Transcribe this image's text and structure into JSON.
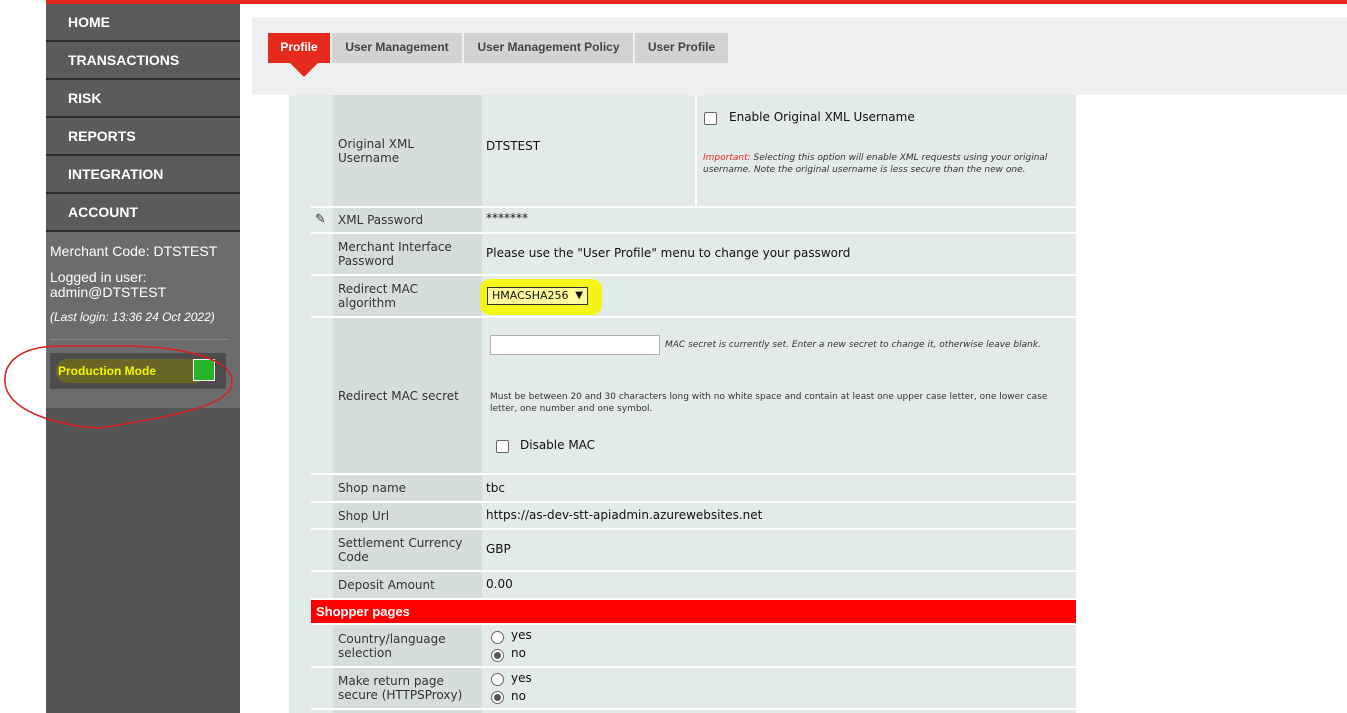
{
  "sidebar": {
    "nav": [
      "HOME",
      "TRANSACTIONS",
      "RISK",
      "REPORTS",
      "INTEGRATION",
      "ACCOUNT"
    ],
    "merchant_code": "Merchant Code: DTSTEST",
    "logged_in_label": "Logged in user:",
    "logged_in_user": "admin@DTSTEST",
    "last_login": "(Last login: 13:36 24 Oct 2022)",
    "production_mode_label": "Production Mode"
  },
  "tabs": [
    "Profile",
    "User Management",
    "User Management Policy",
    "User Profile"
  ],
  "form": {
    "original_xml_username": {
      "label": "Original XML Username",
      "value": "DTSTEST",
      "checkbox_label": "Enable Original XML Username",
      "note_important": "Important:",
      "note_text": " Selecting this option will enable XML requests using your original username. Note the original username is less secure than the new one."
    },
    "xml_password": {
      "label": "XML Password",
      "value": "*******"
    },
    "merchant_interface_password": {
      "label": "Merchant Interface Password",
      "value": "Please use the \"User Profile\" menu to change your password"
    },
    "redirect_mac_algorithm": {
      "label": "Redirect MAC algorithm",
      "selected": "HMACSHA256"
    },
    "redirect_mac_secret": {
      "label": "Redirect MAC secret",
      "note1": "MAC secret is currently set. Enter a new secret to change it, otherwise leave blank.",
      "note2": "Must be between 20 and 30 characters long with no white space and contain at least one upper case letter, one lower case letter, one number and one symbol.",
      "disable_label": "Disable MAC"
    },
    "shop_name": {
      "label": "Shop name",
      "value": "tbc"
    },
    "shop_url": {
      "label": "Shop Url",
      "value": "https://as-dev-stt-apiadmin.azurewebsites.net"
    },
    "settlement_currency": {
      "label": "Settlement Currency Code",
      "value": "GBP"
    },
    "deposit_amount": {
      "label": "Deposit Amount",
      "value": "0.00"
    }
  },
  "shopper_pages": {
    "title": "Shopper pages",
    "country_language": {
      "label": "Country/language selection",
      "yes": "yes",
      "no": "no",
      "selected": "no"
    },
    "return_page_secure": {
      "label": "Make return page secure (HTTPSProxy)",
      "yes": "yes",
      "no": "no",
      "selected": "no"
    }
  },
  "colors": {
    "accent_red": "#e62a1e",
    "sidebar_bg": "#545454",
    "highlight_yellow": "#f5f500",
    "production_green": "#27b327"
  }
}
